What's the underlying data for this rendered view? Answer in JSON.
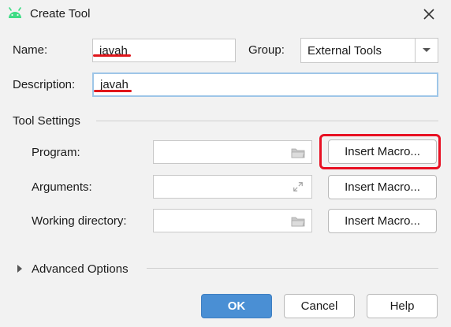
{
  "window": {
    "title": "Create Tool",
    "app_icon": "android-icon",
    "close_icon": "close-icon"
  },
  "form": {
    "name_label": "Name:",
    "name_value": "javah",
    "group_label": "Group:",
    "group_value": "External Tools",
    "description_label": "Description:",
    "description_value": "javah"
  },
  "tool_settings": {
    "title": "Tool Settings",
    "program_label": "Program:",
    "program_value": "",
    "arguments_label": "Arguments:",
    "arguments_value": "",
    "working_dir_label": "Working directory:",
    "working_dir_value": "",
    "insert_macro_label": "Insert Macro..."
  },
  "advanced": {
    "title": "Advanced Options"
  },
  "buttons": {
    "ok": "OK",
    "cancel": "Cancel",
    "help": "Help"
  },
  "colors": {
    "accent": "#4a8fd4",
    "annotation_red": "#e81123",
    "android_green": "#3ddc84"
  }
}
